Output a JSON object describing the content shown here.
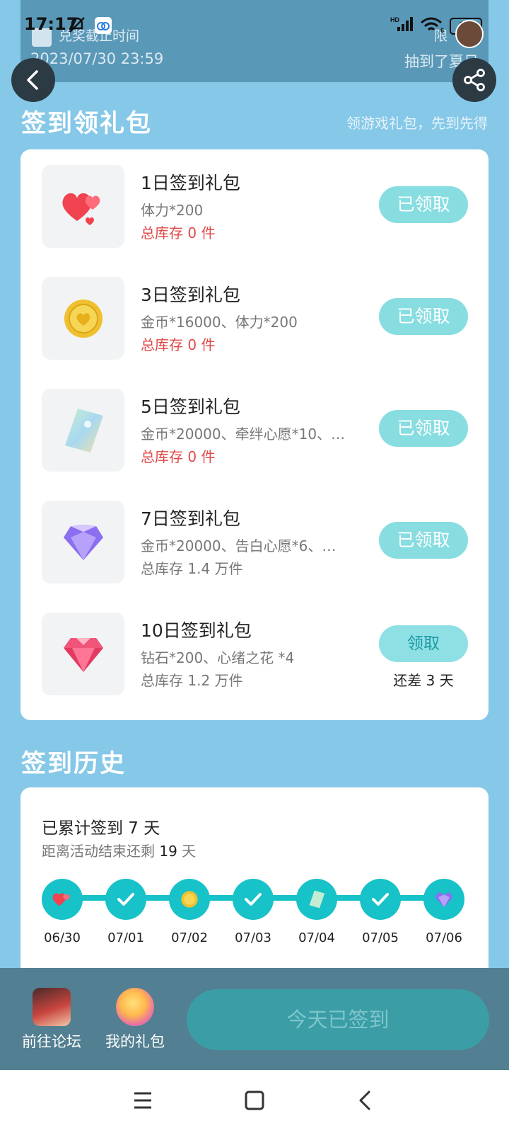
{
  "status": {
    "time": "17:17",
    "battery": "99",
    "net": "HD",
    "sim": "6"
  },
  "banner": {
    "left_label": "兑奖截止时间",
    "left_date": "2023/07/30 23:59",
    "right_label": "限",
    "right_sub": "抽到了夏日"
  },
  "signin": {
    "title": "签到领礼包",
    "subtitle": "领游戏礼包，先到先得",
    "gifts": [
      {
        "name": "1日签到礼包",
        "desc": "体力*200",
        "stock": "总库存 0 件",
        "button": "已领取"
      },
      {
        "name": "3日签到礼包",
        "desc": "金币*16000、体力*200",
        "stock": "总库存 0 件",
        "button": "已领取"
      },
      {
        "name": "5日签到礼包",
        "desc": "金币*20000、牵绊心愿*10、…",
        "stock": "总库存 0 件",
        "button": "已领取"
      },
      {
        "name": "7日签到礼包",
        "desc": "金币*20000、告白心愿*6、…",
        "stock": "总库存 1.4 万件",
        "button": "已领取"
      },
      {
        "name": "10日签到礼包",
        "desc": "钻石*200、心绪之花 *4",
        "stock": "总库存 1.2 万件",
        "button": "领取",
        "remain": "还差 3 天"
      }
    ]
  },
  "history": {
    "title": "签到历史",
    "total": "已累计签到 7 天",
    "left_prefix": "距离活动结束还剩 ",
    "left_days": "19",
    "left_suffix": " 天",
    "days": [
      {
        "date": "06/30",
        "icon": "hearts-icon"
      },
      {
        "date": "07/01",
        "icon": "check-icon"
      },
      {
        "date": "07/02",
        "icon": "coin-icon"
      },
      {
        "date": "07/03",
        "icon": "check-icon"
      },
      {
        "date": "07/04",
        "icon": "card-icon"
      },
      {
        "date": "07/05",
        "icon": "check-icon"
      },
      {
        "date": "07/06",
        "icon": "purple-gem-icon"
      }
    ]
  },
  "bottom": {
    "forum": "前往论坛",
    "my_gifts": "我的礼包",
    "signed": "今天已签到"
  },
  "colors": {
    "accent": "#17c2c8",
    "stock_empty": "#e04848",
    "background": "#86c8e8"
  }
}
